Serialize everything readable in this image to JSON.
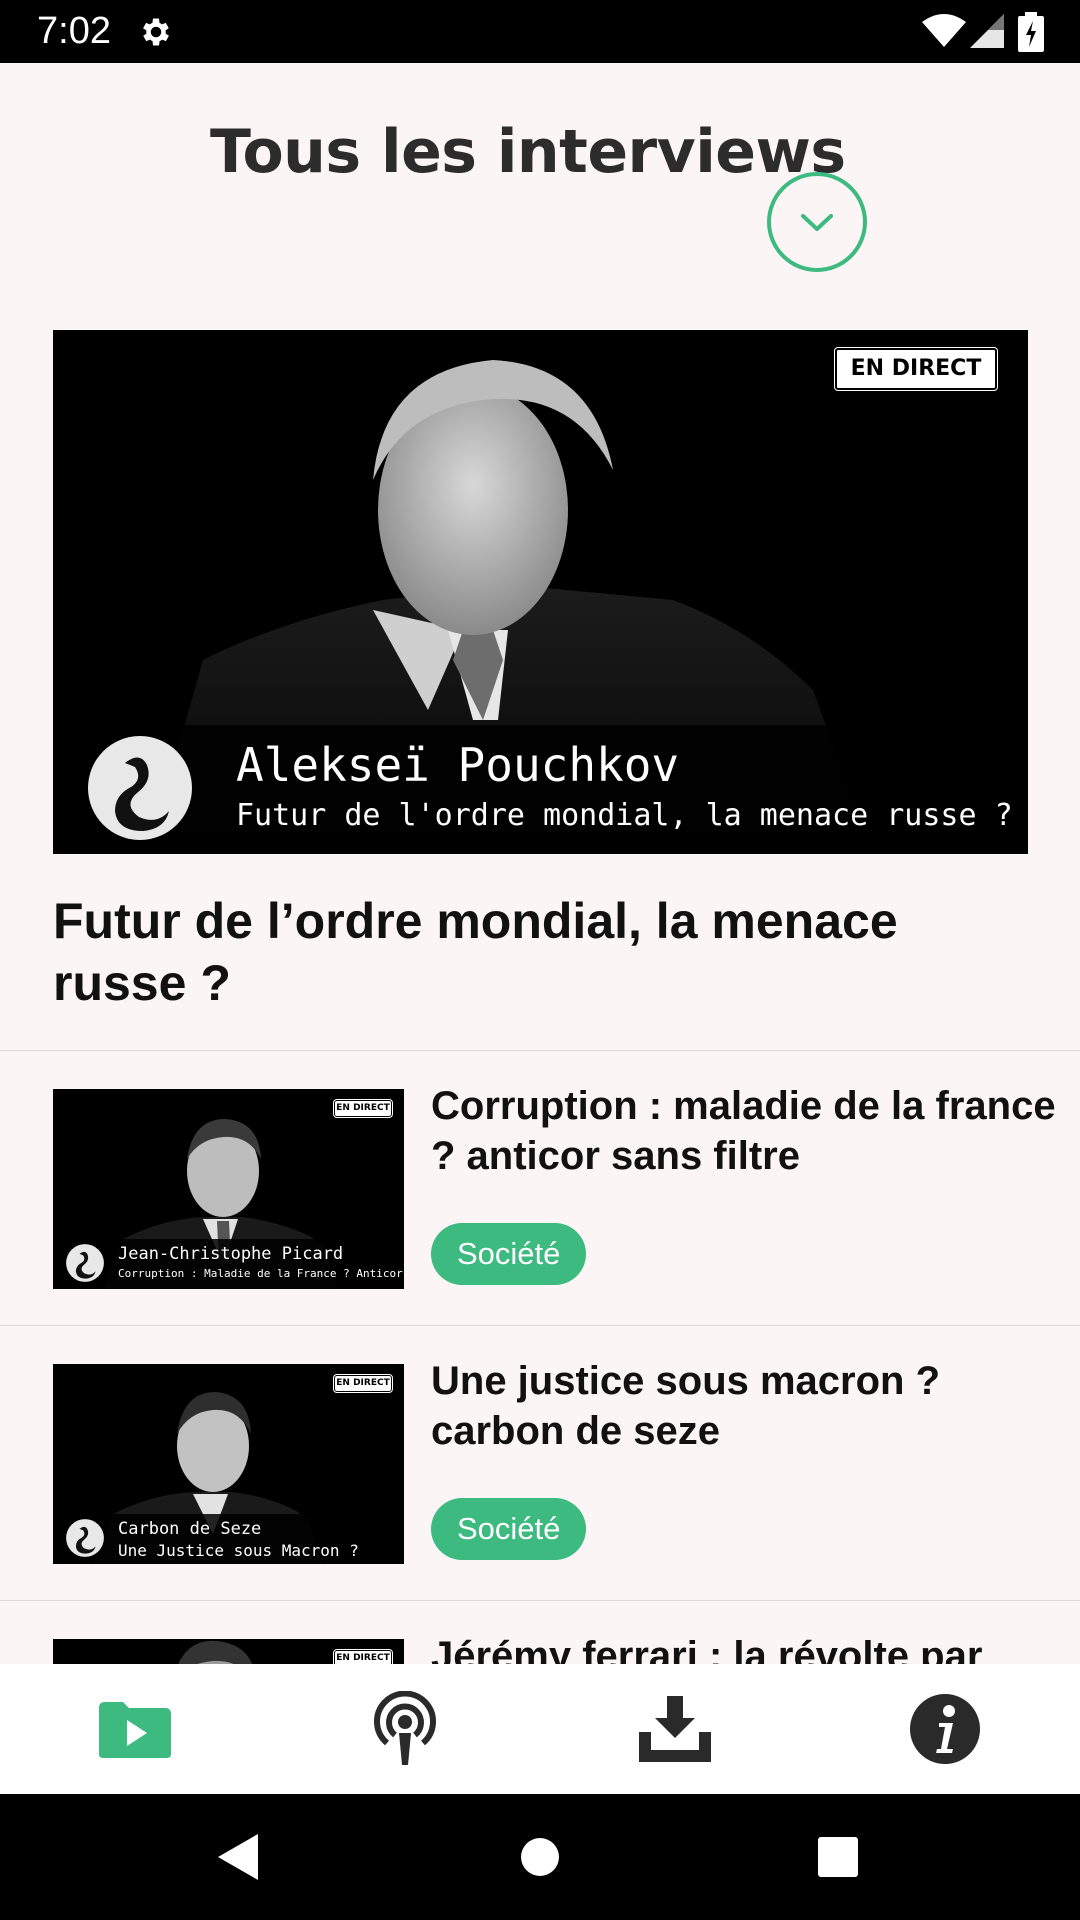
{
  "status_bar": {
    "time": "7:02",
    "icons": [
      "gear-icon",
      "wifi-icon",
      "signal-icon",
      "battery-icon"
    ]
  },
  "header": {
    "title": "Tous les interviews",
    "dropdown_icon": "chevron-down-icon"
  },
  "featured": {
    "badge": "EN DIRECT",
    "thumb_name": "Alekseï Pouchkov",
    "thumb_subtitle": "Futur de l'ordre mondial, la menace russe ?",
    "title": "Futur de l’ordre mondial, la menace russe ?"
  },
  "items": [
    {
      "badge": "EN DIRECT",
      "thumb_name": "Jean-Christophe Picard",
      "thumb_subtitle": "Corruption : Maladie de la France ? Anticor sans filtre",
      "title": "Corruption : maladie de la france ? anticor sans filtre",
      "category": "Société"
    },
    {
      "badge": "EN DIRECT",
      "thumb_name": "Carbon de Seze",
      "thumb_subtitle": "Une Justice sous Macron ?",
      "title": "Une justice sous macron ? carbon de seze",
      "category": "Société"
    },
    {
      "badge": "EN DIRECT",
      "title": "Jérémy ferrari : la révolte par"
    }
  ],
  "bottom_nav": [
    {
      "icon": "video-folder-icon",
      "active": true
    },
    {
      "icon": "podcast-icon",
      "active": false
    },
    {
      "icon": "download-icon",
      "active": false
    },
    {
      "icon": "info-icon",
      "active": false
    }
  ],
  "colors": {
    "accent": "#3dba7f",
    "background": "#fbf5f6",
    "text": "#111111"
  }
}
